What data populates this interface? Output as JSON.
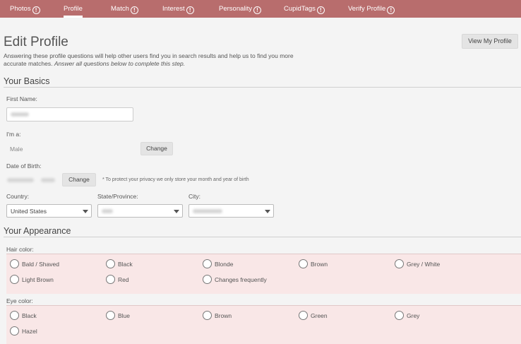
{
  "nav": {
    "tabs": [
      {
        "label": "Photos",
        "badge": "!"
      },
      {
        "label": "Profile",
        "badge": ""
      },
      {
        "label": "Match",
        "badge": "!"
      },
      {
        "label": "Interest",
        "badge": "!"
      },
      {
        "label": "Personality",
        "badge": "!"
      },
      {
        "label": "CupidTags",
        "badge": "!"
      },
      {
        "label": "Verify Profile",
        "badge": "!"
      }
    ]
  },
  "header": {
    "title": "Edit Profile",
    "view_button": "View My Profile",
    "intro_text": "Answering these profile questions will help other users find you in search results and help us to find you more accurate matches.",
    "intro_emphasis": "Answer all questions below to complete this step."
  },
  "basics": {
    "title": "Your Basics",
    "first_name_label": "First Name:",
    "im_a_label": "I'm a:",
    "im_a_value": "Male",
    "change_label": "Change",
    "dob_label": "Date of Birth:",
    "dob_change_label": "Change",
    "dob_note": "* To protect your privacy we only store your month and year of birth",
    "country_label": "Country:",
    "country_value": "United States",
    "state_label": "State/Province:",
    "city_label": "City:"
  },
  "appearance": {
    "title": "Your Appearance",
    "hair_label": "Hair color:",
    "hair_options": [
      "Bald / Shaved",
      "Black",
      "Blonde",
      "Brown",
      "Grey / White",
      "Light Brown",
      "Red",
      "Changes frequently"
    ],
    "eye_label": "Eye color:",
    "eye_options": [
      "Black",
      "Blue",
      "Brown",
      "Green",
      "Grey",
      "Hazel"
    ]
  },
  "colors": {
    "nav_bg": "#b86d6d",
    "panel_bg": "#f9e7e7"
  }
}
